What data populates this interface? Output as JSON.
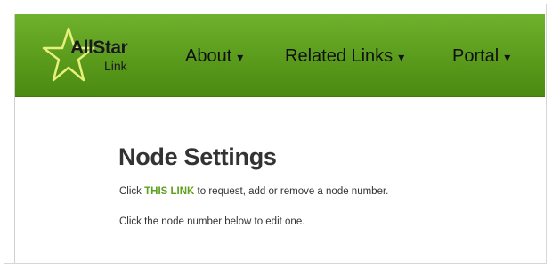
{
  "nav": {
    "logo": {
      "word": "AllStar",
      "sub": "Link"
    },
    "items": [
      {
        "label": "About",
        "caret": "▾"
      },
      {
        "label": "Related Links",
        "caret": "▾"
      },
      {
        "label": "Portal",
        "caret": "▾"
      }
    ]
  },
  "main": {
    "title": "Node Settings",
    "line1_prefix": "Click ",
    "line1_link": "THIS LINK",
    "line1_suffix": " to request, add or remove a node number.",
    "line2": "Click the node number below to edit one."
  },
  "colors": {
    "navbar": "#5a9b1c",
    "link": "#5ea11c",
    "star_outline": "#e7f07a"
  }
}
